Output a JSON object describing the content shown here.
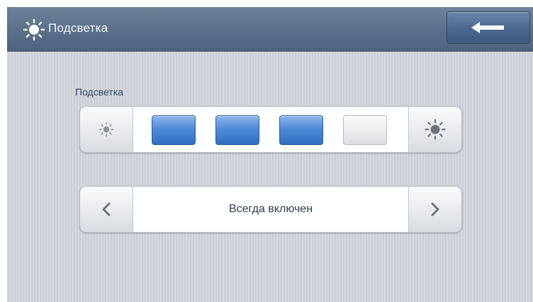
{
  "header": {
    "title": "Подсветка",
    "icon": "sun-icon"
  },
  "back_button": {
    "icon": "arrow-left-icon"
  },
  "brightness": {
    "label": "Подсветка",
    "decrease_icon": "sun-small-icon",
    "increase_icon": "sun-large-icon",
    "level": 3,
    "max_level": 4
  },
  "mode": {
    "value": "Всегда включен",
    "prev_icon": "chevron-left-icon",
    "next_icon": "chevron-right-icon"
  },
  "colors": {
    "header": "#5b6f89",
    "level_on": "#4f8ad6",
    "level_off": "#e9eaec",
    "text": "#2d3c50"
  }
}
